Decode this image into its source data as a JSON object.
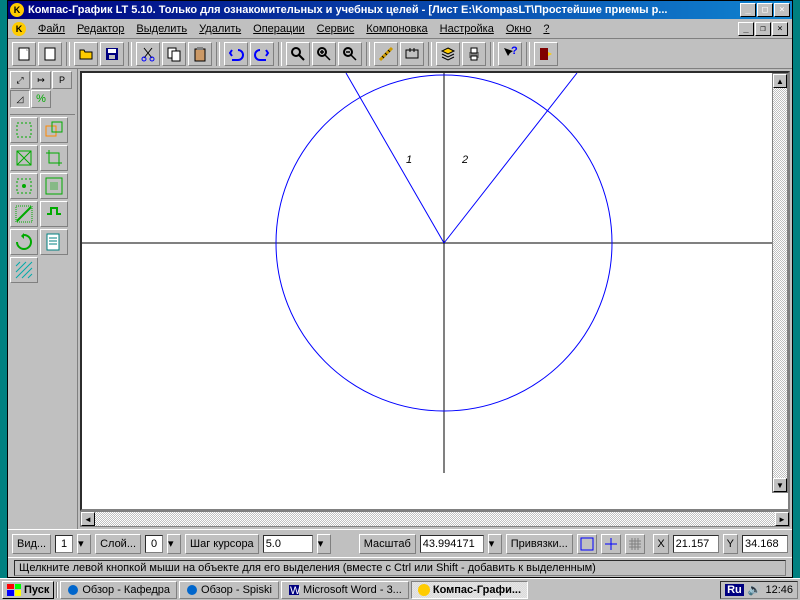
{
  "title": "Компас-График LT 5.10. Только для ознакомительных и учебных целей - [Лист E:\\KompasLT\\Простейшие приемы р...",
  "menu": [
    "Файл",
    "Редактор",
    "Выделить",
    "Удалить",
    "Операции",
    "Сервис",
    "Компоновка",
    "Настройка",
    "Окно",
    "?"
  ],
  "parambar": {
    "view_label": "Вид...",
    "view_value": "1",
    "layer_label": "Слой...",
    "layer_value": "0",
    "step_label": "Шаг курсора",
    "step_value": "5.0",
    "scale_label": "Масштаб",
    "scale_value": "43.994171",
    "snap_label": "Привязки...",
    "x_label": "X",
    "x_value": "21.157",
    "y_label": "Y",
    "y_value": "34.168"
  },
  "status": "Щелкните левой кнопкой мыши на объекте для его выделения (вместе с Ctrl или Shift - добавить к выделенным)",
  "taskbar": {
    "start": "Пуск",
    "tasks": [
      "Обзор - Кафедра",
      "Обзор - Spiski",
      "Microsoft Word - 3...",
      "Компас-Графи..."
    ],
    "lang": "Ru",
    "time": "12:46"
  },
  "canvas_text": {
    "one": "1",
    "two": "2"
  }
}
